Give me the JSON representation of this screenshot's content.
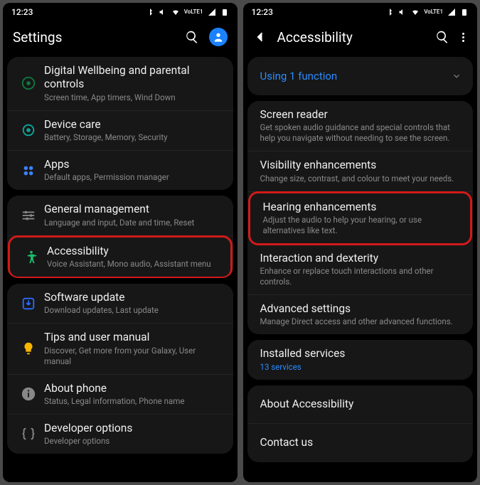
{
  "status": {
    "time": "12:23",
    "lte": "VoLTE1"
  },
  "left": {
    "title": "Settings",
    "group1": [
      {
        "icon": "wellbeing",
        "title": "Digital Wellbeing and parental controls",
        "sub": "Screen time, App timers, Wind Down"
      },
      {
        "icon": "care",
        "title": "Device care",
        "sub": "Battery, Storage, Memory, Security"
      },
      {
        "icon": "apps",
        "title": "Apps",
        "sub": "Default apps, Permission manager"
      }
    ],
    "group2": [
      {
        "icon": "general",
        "title": "General management",
        "sub": "Language and input, Date and time, Reset"
      },
      {
        "icon": "accessibility",
        "title": "Accessibility",
        "sub": "Voice Assistant, Mono audio, Assistant menu",
        "hl": true
      }
    ],
    "group3": [
      {
        "icon": "update",
        "title": "Software update",
        "sub": "Download updates, Last update"
      },
      {
        "icon": "tips",
        "title": "Tips and user manual",
        "sub": "Discover, Get more from your Galaxy, User manual"
      },
      {
        "icon": "about",
        "title": "About phone",
        "sub": "Status, Legal information, Phone name"
      },
      {
        "icon": "dev",
        "title": "Developer options",
        "sub": "Developer options"
      }
    ]
  },
  "right": {
    "title": "Accessibility",
    "banner": "Using 1 function",
    "group1": [
      {
        "title": "Screen reader",
        "sub": "Get spoken audio guidance and special controls that help you navigate without needing to see the screen."
      },
      {
        "title": "Visibility enhancements",
        "sub": "Change size, contrast, and colour to meet your needs."
      },
      {
        "title": "Hearing enhancements",
        "sub": "Adjust the audio to help your hearing, or use alternatives like text.",
        "hl": true
      },
      {
        "title": "Interaction and dexterity",
        "sub": "Enhance or replace touch interactions and other controls."
      },
      {
        "title": "Advanced settings",
        "sub": "Manage Direct access and other advanced functions."
      }
    ],
    "group2": [
      {
        "title": "Installed services",
        "sub": "13 services",
        "subBlue": true
      }
    ],
    "group3": [
      {
        "title": "About Accessibility"
      },
      {
        "title": "Contact us"
      }
    ]
  }
}
